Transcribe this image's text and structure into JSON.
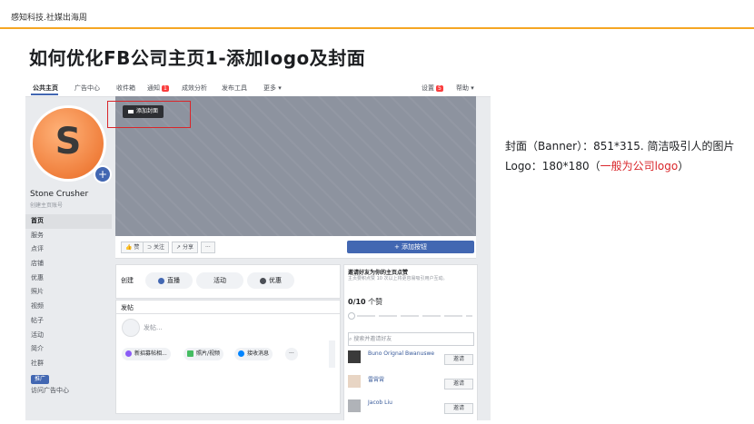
{
  "header": {
    "brand": "感知科技.社媒出海周",
    "title": "如何优化FB公司主页1-添加logo及封面"
  },
  "fb": {
    "nav": [
      {
        "label": "公共主页"
      },
      {
        "label": "广告中心"
      },
      {
        "label": "收件箱"
      },
      {
        "label": "通知",
        "badge": "1"
      },
      {
        "label": "成效分析"
      },
      {
        "label": "发布工具"
      },
      {
        "label": "更多 ▾"
      }
    ],
    "nav_right": {
      "settings": "设置",
      "settings_badge": "5",
      "help": "帮助 ▾"
    },
    "avatar_letter": "S",
    "page_name": "Stone Crusher",
    "page_handle": "创建主页账号",
    "sidebar": [
      "首页",
      "服务",
      "点评",
      "店铺",
      "优惠",
      "照片",
      "视频",
      "帖子",
      "活动",
      "简介",
      "社群"
    ],
    "promote": "推广",
    "ad_center": "访问广告中心",
    "add_cover": "添加封面",
    "actions": {
      "like": "赞",
      "follow": "关注",
      "share": "分享",
      "more": "···",
      "cta": "+ 添加按钮"
    },
    "create": {
      "label": "创建",
      "live": "直播",
      "event": "活动",
      "offer": "优惠"
    },
    "post": {
      "label": "发帖",
      "placeholder": "发帖...",
      "opt1": "新招募帖相...",
      "opt2": "照片/视频",
      "opt3": "接收消息",
      "more": "···"
    },
    "invite": {
      "title": "邀请好友为你的主页点赞",
      "desc": "主页要积点赞 10 次以上将更容易吸引用户互动。",
      "count": "0/10",
      "count_suffix": " 个赞",
      "search": "搜索并邀请好友",
      "friends": [
        {
          "name": "Buno Orignal Bwanuswe",
          "btn": "邀请"
        },
        {
          "name": "雷霄霄",
          "btn": "邀请"
        },
        {
          "name": "Jacob Liu",
          "btn": "邀请"
        }
      ]
    }
  },
  "note": {
    "line1": "封面（Banner）：851*315. 简洁吸引人的图片",
    "line2_pre": "Logo：180*180（",
    "line2_red": "一般为公司logo",
    "line2_post": "）"
  },
  "colors": {
    "accent": "#f5a623",
    "fb_blue": "#4267b2",
    "highlight_red": "#d9262a"
  }
}
